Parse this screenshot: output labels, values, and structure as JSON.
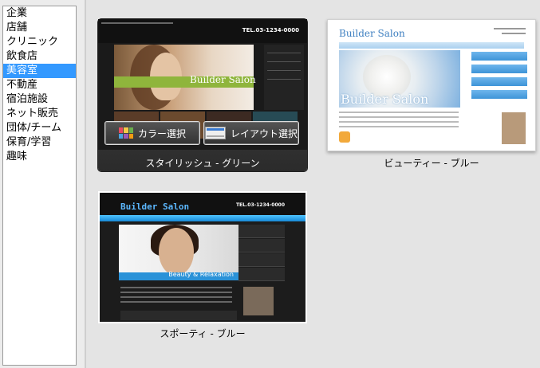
{
  "sidebar": {
    "items": [
      {
        "label": "企業",
        "selected": false
      },
      {
        "label": "店舗",
        "selected": false
      },
      {
        "label": "クリニック",
        "selected": false
      },
      {
        "label": "飲食店",
        "selected": false
      },
      {
        "label": "美容室",
        "selected": true
      },
      {
        "label": "不動産",
        "selected": false
      },
      {
        "label": "宿泊施設",
        "selected": false
      },
      {
        "label": "ネット販売",
        "selected": false
      },
      {
        "label": "団体/チーム",
        "selected": false
      },
      {
        "label": "保育/学習",
        "selected": false
      },
      {
        "label": "趣味",
        "selected": false
      }
    ]
  },
  "templates": [
    {
      "label": "スタイリッシュ - グリーン",
      "selected": true,
      "preview": {
        "brand": "Builder Salon",
        "tel": "TEL.03-1234-0000"
      },
      "buttons": {
        "color": "カラー選択",
        "layout": "レイアウト選択"
      }
    },
    {
      "label": "ビューティー - ブルー",
      "selected": false,
      "preview": {
        "brand": "Builder Salon"
      }
    },
    {
      "label": "スポーティ - ブルー",
      "selected": false,
      "preview": {
        "brand": "Builder Salon",
        "tel": "TEL.03-1234-0000",
        "tagline": "Beauty & Relaxation"
      }
    }
  ],
  "colors": {
    "selection": "#3399ff",
    "accent_green": "#8fb53c",
    "accent_blue": "#2a92d8"
  }
}
